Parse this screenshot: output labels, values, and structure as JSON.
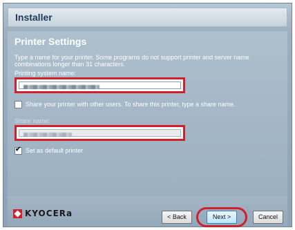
{
  "window": {
    "title": "Installer"
  },
  "page": {
    "heading": "Printer Settings",
    "description": "Type a name for your printer. Some programs do not support printer and server name combinations longer than 31 characters."
  },
  "printing_system_name": {
    "label": "Printing system name:",
    "value": ""
  },
  "share": {
    "checkbox_label": "Share your printer with other users. To share this printer, type a share name.",
    "checked": false,
    "share_name_label": "Share name:",
    "share_name_value": ""
  },
  "default_printer": {
    "checkbox_label": "Set as default printer",
    "checked": true
  },
  "footer": {
    "logo_text": "KYOCERa",
    "back_label": "< Back",
    "next_label": "Next >",
    "cancel_label": "Cancel"
  },
  "colors": {
    "highlight": "#d0202c",
    "panel": "#9cb0c1"
  }
}
